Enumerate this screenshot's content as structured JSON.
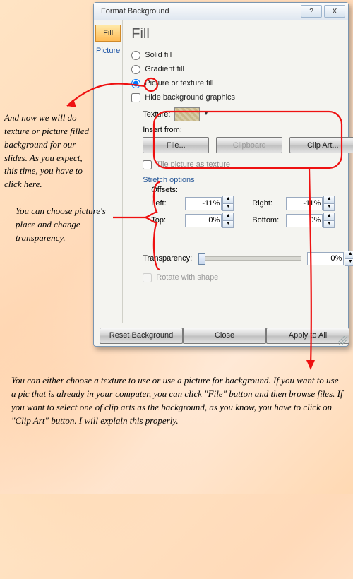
{
  "dialog": {
    "title": "Format Background",
    "help_btn": "?",
    "close_btn": "X"
  },
  "sidebar": {
    "tab_fill": "Fill",
    "tab_picture": "Picture"
  },
  "panel": {
    "heading": "Fill",
    "radio_solid": "Solid fill",
    "radio_gradient": "Gradient fill",
    "radio_picture": "Picture or texture fill",
    "check_hide": "Hide background graphics",
    "texture_label": "Texture:",
    "insert_from": "Insert from:",
    "btn_file": "File...",
    "btn_clipboard": "Clipboard",
    "btn_clipart": "Clip Art...",
    "check_tile": "Tile picture as texture",
    "stretch_header": "Stretch options",
    "offsets_label": "Offsets:",
    "offset_left_label": "Left:",
    "offset_left_value": "-11%",
    "offset_right_label": "Right:",
    "offset_right_value": "-11%",
    "offset_top_label": "Top:",
    "offset_top_value": "0%",
    "offset_bottom_label": "Bottom:",
    "offset_bottom_value": "0%",
    "transparency_label": "Transparency:",
    "transparency_value": "0%",
    "check_rotate": "Rotate with shape"
  },
  "footer": {
    "reset": "Reset Background",
    "close": "Close",
    "apply": "Apply to All"
  },
  "annotations": {
    "a1": "And now we will do texture or picture filled background for our slides. As you expect, this time, you have to click here.",
    "a2": "You can choose picture's place and change transparency.",
    "a3": "You can either choose a texture to use or use a picture for background. If you want to use a pic that is already in your computer, you can click \"File\" button and then browse files. If you want to select one of clip arts as the background, as you know, you have to click on \"Clip Art\" button. I will explain this properly."
  }
}
